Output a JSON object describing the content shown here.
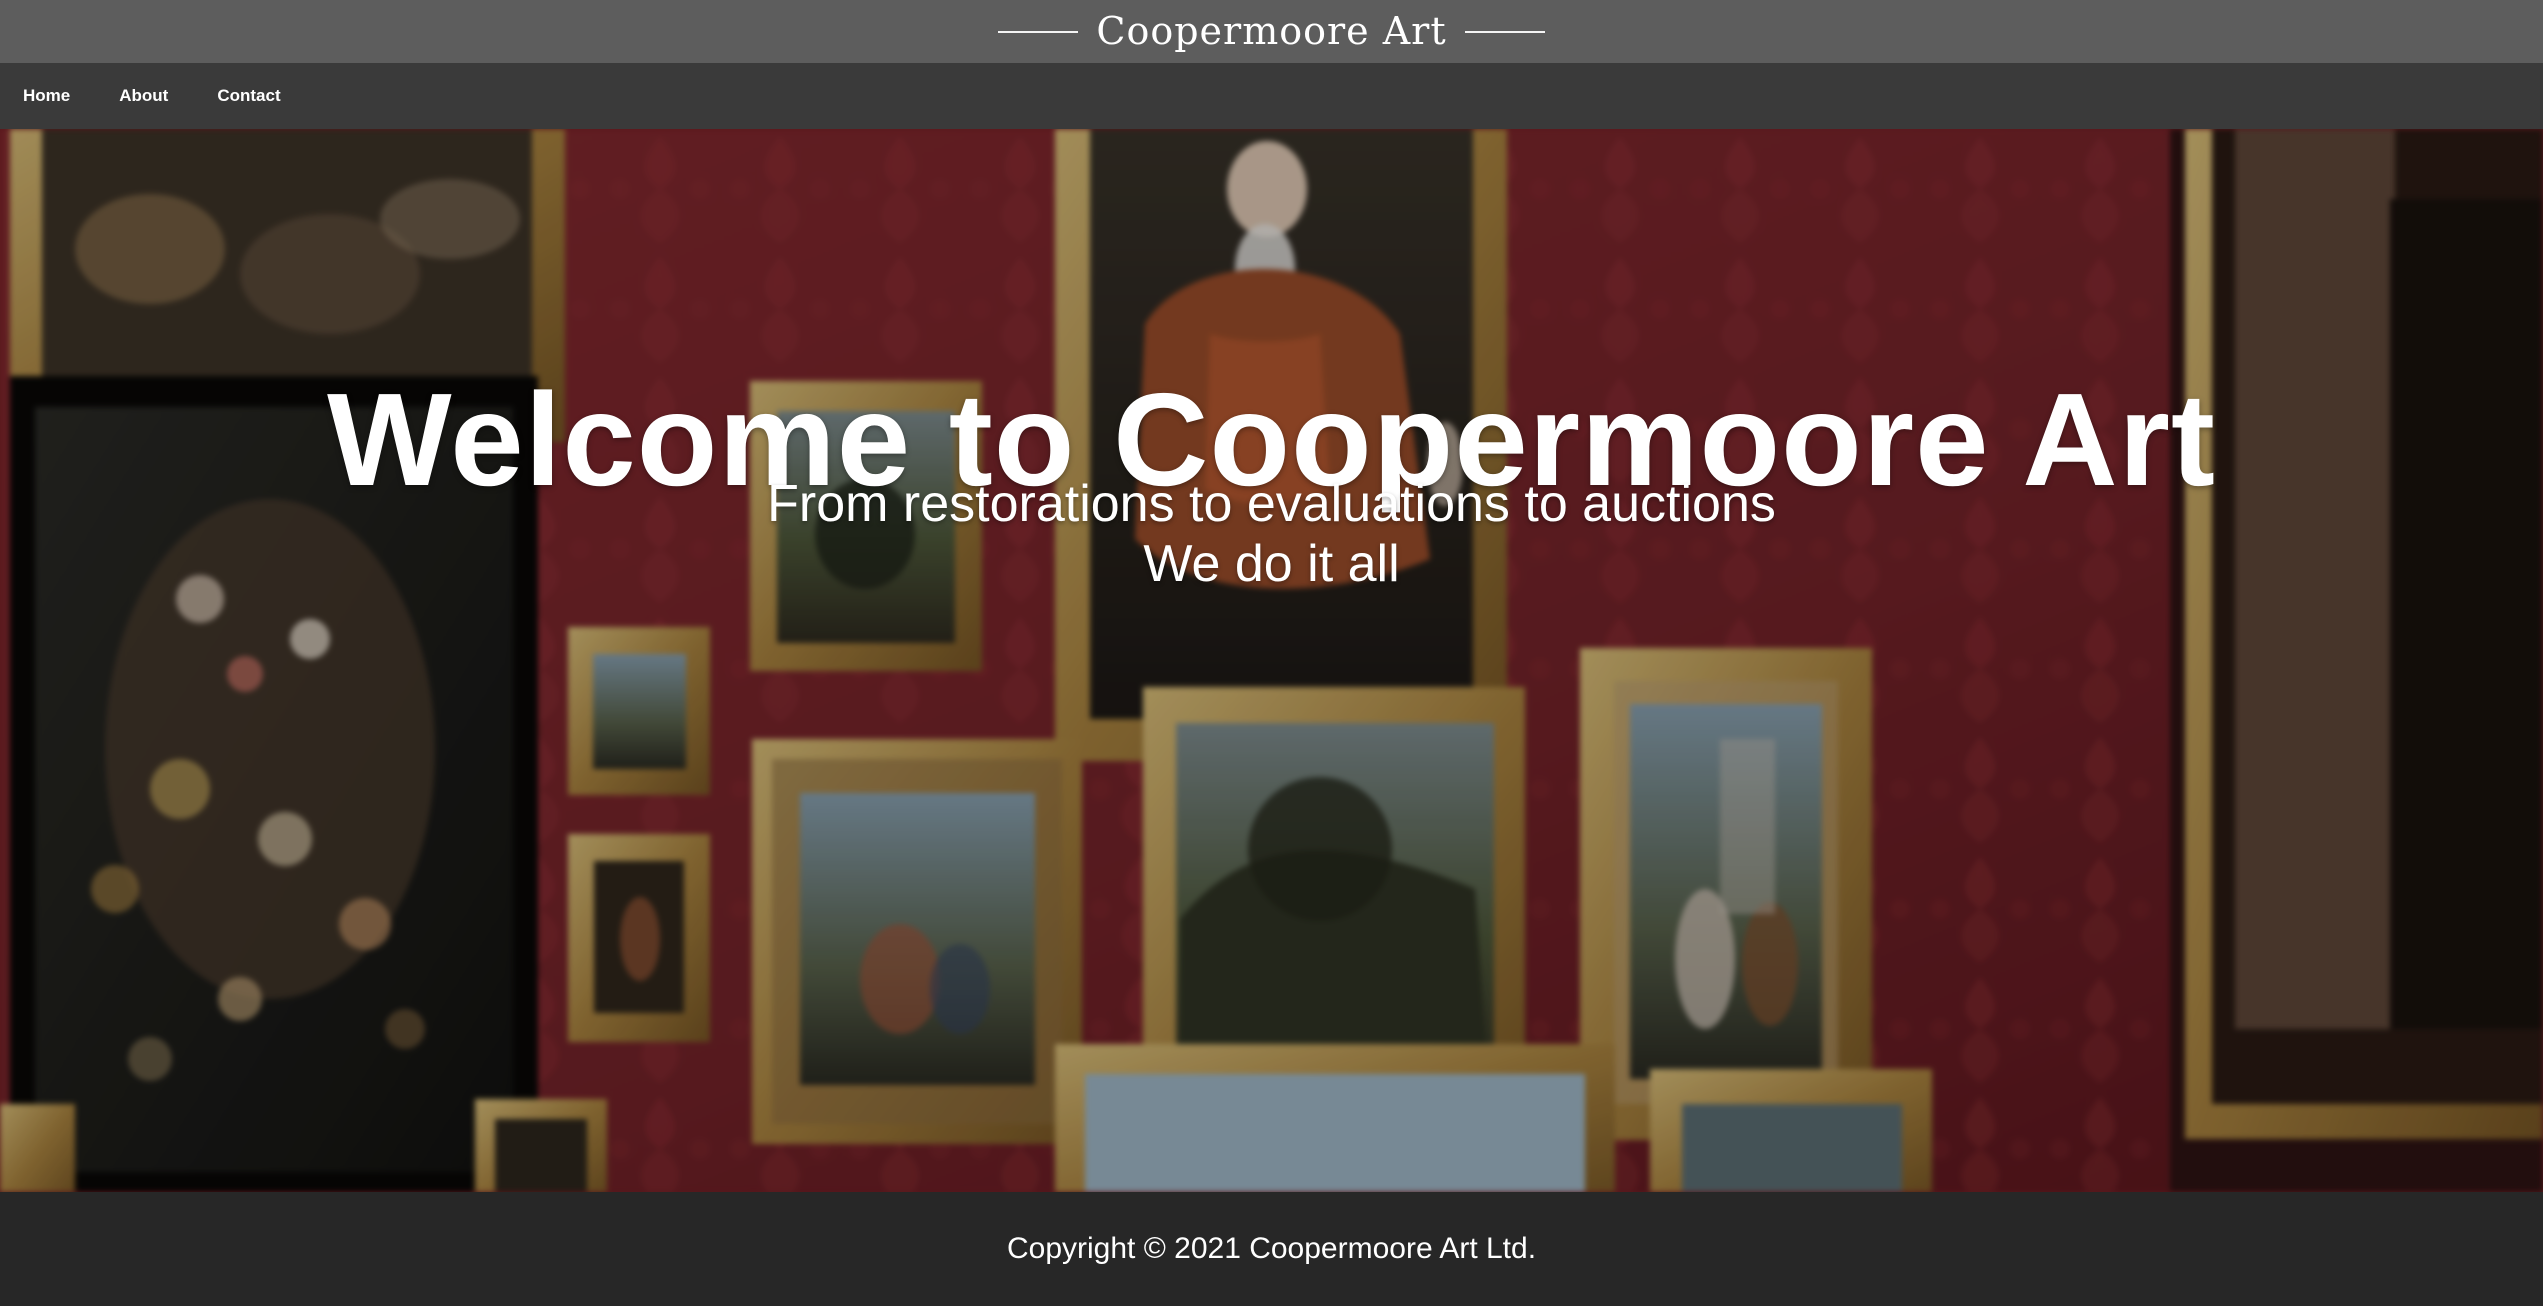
{
  "header": {
    "brand_title": "Coopermoore Art"
  },
  "nav": {
    "items": [
      {
        "label": "Home"
      },
      {
        "label": "About"
      },
      {
        "label": "Contact"
      }
    ]
  },
  "hero": {
    "title": "Welcome to Coopermoore Art",
    "subtitle_line1": "From restorations to evaluations to auctions",
    "subtitle_line2": "We do it all"
  },
  "footer": {
    "copyright": "Copyright © 2021 Coopermoore Art Ltd."
  },
  "colors": {
    "brand_bar": "#5d5d5d",
    "nav_bar": "#3a3a3a",
    "footer": "#272727",
    "gallery_wall": "#7a1f24",
    "frame_gold": "#b8944f"
  }
}
